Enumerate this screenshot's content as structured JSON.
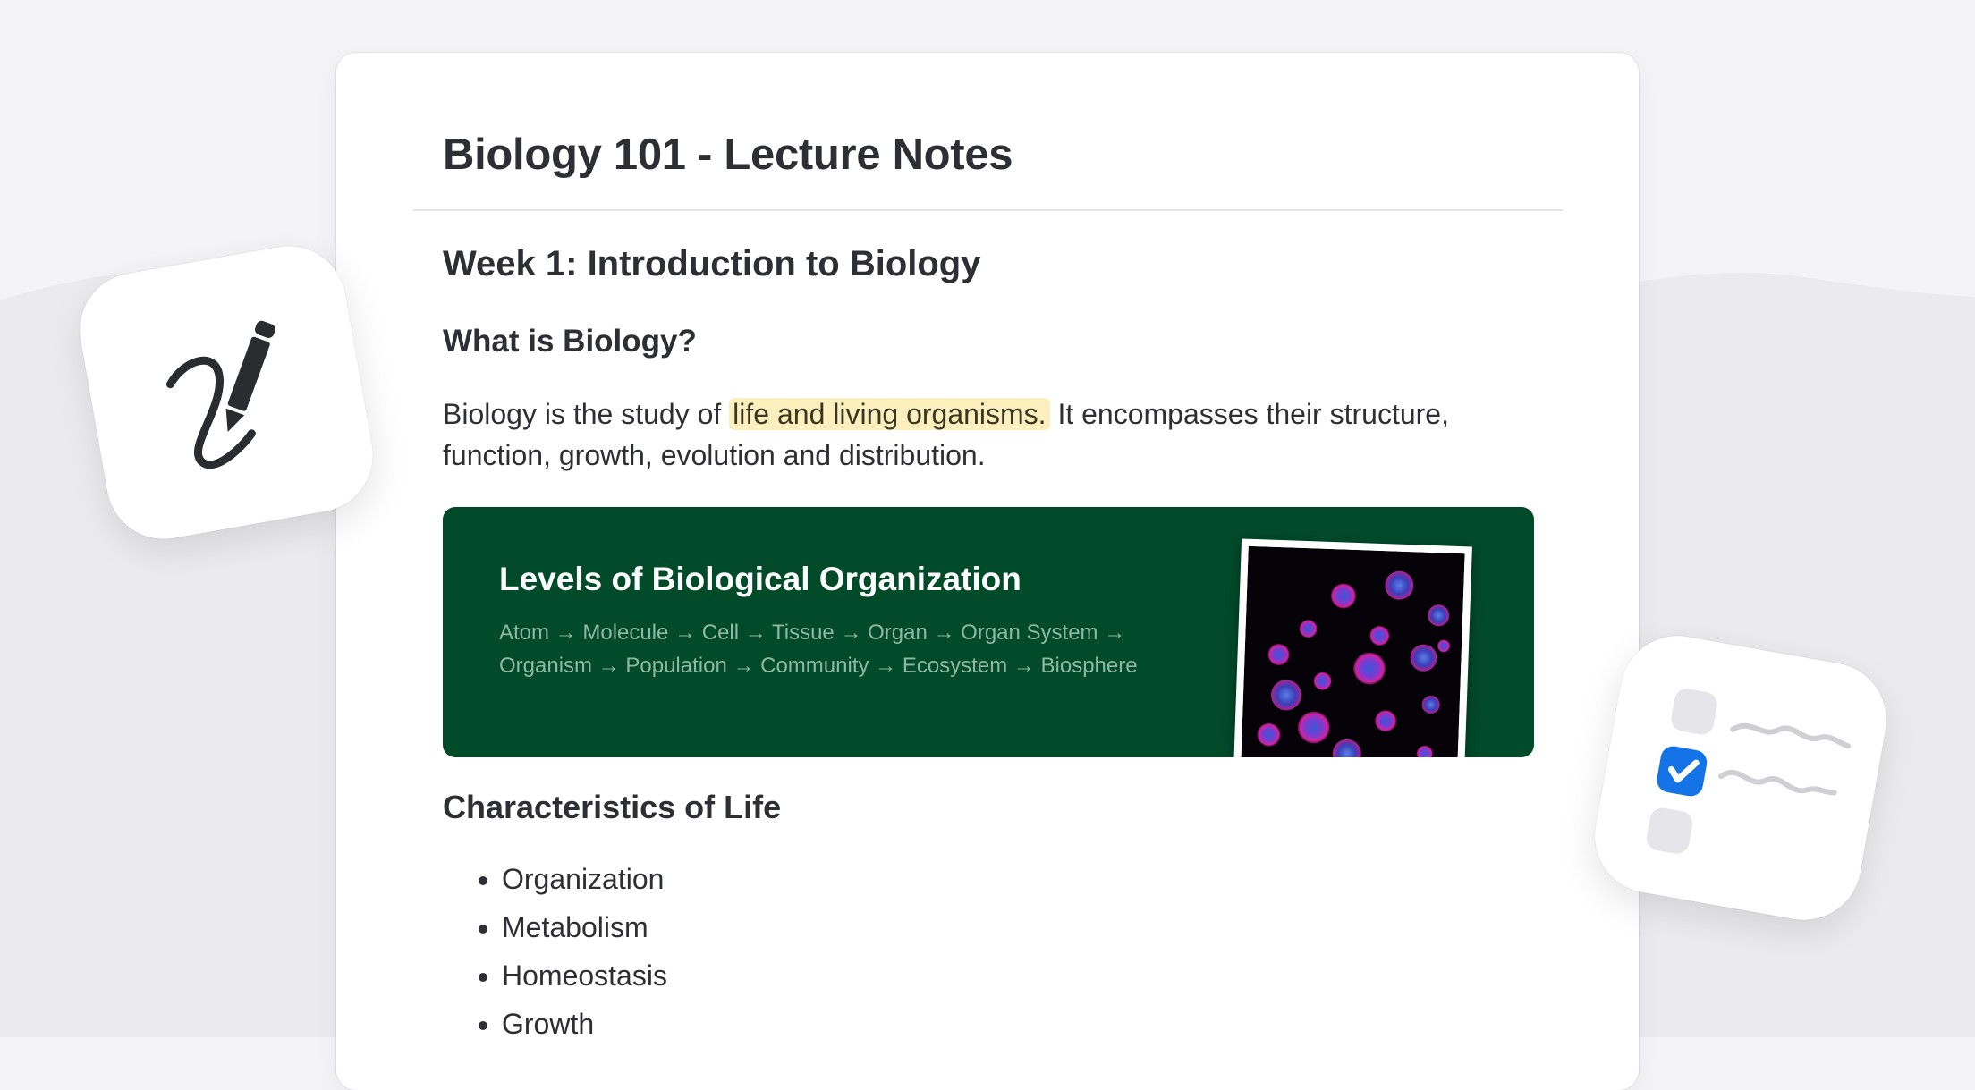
{
  "document": {
    "title": "Biology 101 - Lecture Notes",
    "week_heading": "Week 1: Introduction to Biology",
    "section_heading": "What is Biology?",
    "paragraph": {
      "before": "Biology is the study of ",
      "highlight": "life and living organisms.",
      "after": " It encompasses their structure, function, growth, evolution and distribution."
    },
    "banner": {
      "title": "Levels of Biological Organization",
      "text": "Atom → Molecule → Cell → Tissue → Organ → Organ System → Organism → Population → Community → Ecosystem → Biosphere"
    },
    "characteristics_heading": "Characteristics of Life",
    "characteristics": [
      "Organization",
      "Metabolism",
      "Homeostasis",
      "Growth"
    ]
  },
  "icons": {
    "left": "handwriting-pen-icon",
    "right": "checklist-icon"
  },
  "colors": {
    "banner_bg": "#014a2a",
    "highlight_bg": "#fbefbe",
    "checkbox_blue": "#1473e6"
  }
}
